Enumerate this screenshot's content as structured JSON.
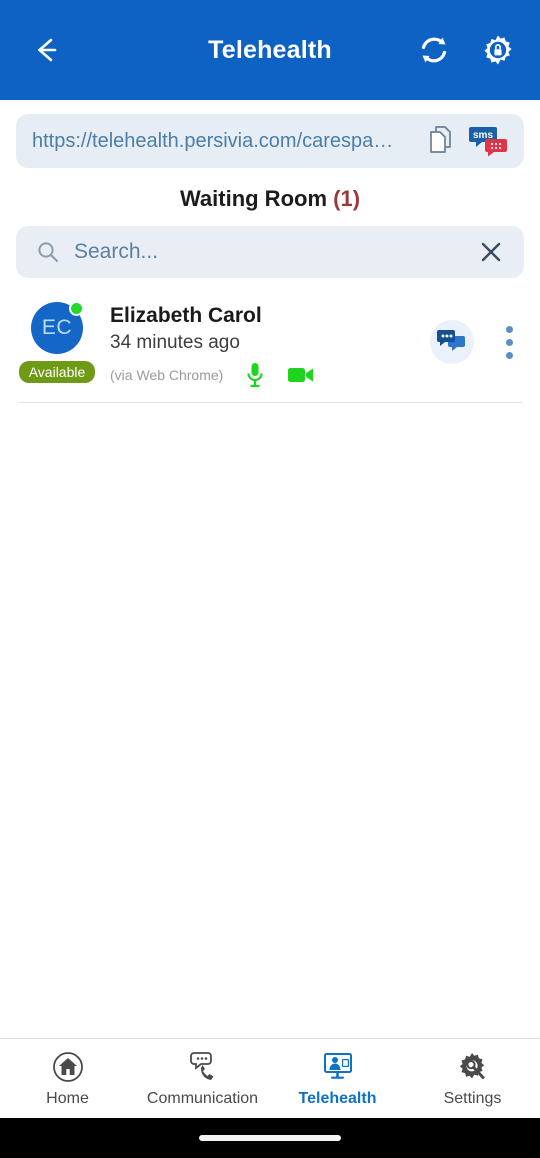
{
  "header": {
    "title": "Telehealth",
    "back_icon": "arrow-left-icon",
    "refresh_icon": "refresh-icon",
    "settings_lock_icon": "gear-lock-icon",
    "bg_color": "#0d62c4"
  },
  "url_bar": {
    "url": "https://telehealth.persivia.com/carespa…",
    "copy_icon": "copy-document-icon",
    "sms_icon": "sms-bubble-icon",
    "sms_label": "sms"
  },
  "section": {
    "title": "Waiting Room",
    "count": "(1)",
    "count_color": "#9b3a3a"
  },
  "search": {
    "placeholder": "Search...",
    "value": "",
    "search_icon": "search-icon",
    "clear_icon": "close-icon"
  },
  "waiting_list": [
    {
      "initials": "EC",
      "name": "Elizabeth Carol",
      "waiting_time": "34 minutes ago",
      "source": "(via Web Chrome)",
      "status": "Available",
      "status_color": "#6f9a15",
      "presence_dot_color": "#22d82a",
      "avatar_color": "#1567c7",
      "mic_icon": "microphone-icon",
      "mic_state_color": "#1fd41f",
      "camera_icon": "video-camera-icon",
      "camera_state_color": "#1fd41f",
      "chat_icon": "chat-bubbles-icon",
      "more_icon": "kebab-menu-icon"
    }
  ],
  "bottom_nav": {
    "active": "Telehealth",
    "active_color": "#1072c4",
    "items": [
      {
        "label": "Home",
        "icon": "home-circle-icon"
      },
      {
        "label": "Communication",
        "icon": "chat-phone-icon"
      },
      {
        "label": "Telehealth",
        "icon": "telehealth-monitor-icon"
      },
      {
        "label": "Settings",
        "icon": "gear-wrench-icon"
      }
    ]
  }
}
